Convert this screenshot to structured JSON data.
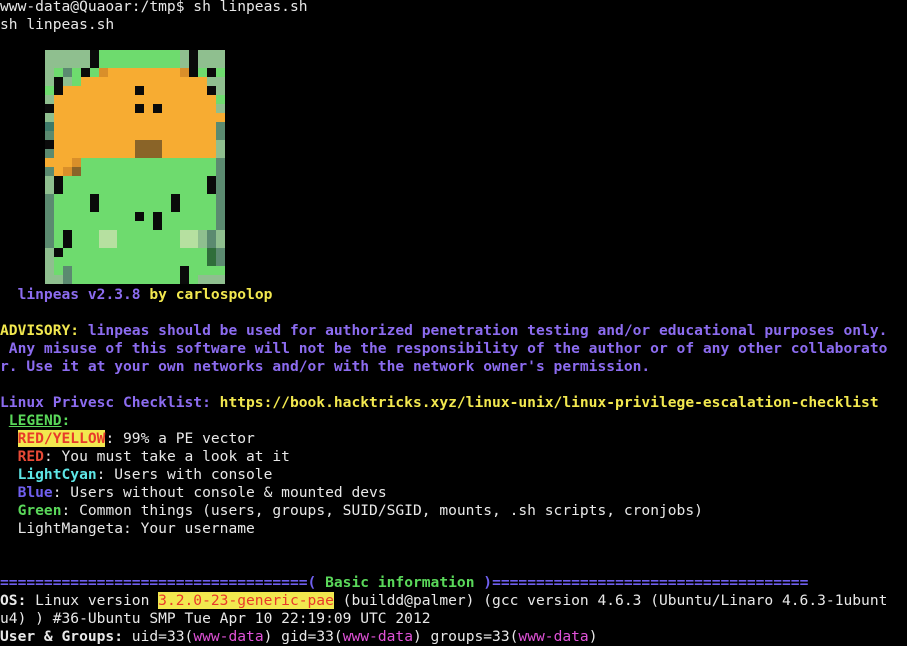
{
  "terminal": {
    "prompt_line": "www-data@Quaoar:/tmp$ sh linpeas.sh",
    "echo_line": "sh linpeas.sh",
    "banner": {
      "name": "linpeas v2.3.8",
      "by": "by",
      "author": "carlospolop"
    },
    "advisory": {
      "label": "ADVISORY:",
      "line1": " linpeas should be used for authorized penetration testing and/or educational purposes only.",
      "line2": " Any misuse of this software will not be the responsibility of the author or of any other collaborato",
      "line3": "r. Use it at your own networks and/or with the network owner's permission."
    },
    "checklist": {
      "label": "Linux Privesc Checklist:",
      "url": " https://book.hacktricks.xyz/linux-unix/linux-privilege-escalation-checklist"
    },
    "legend": {
      "title": "LEGEND",
      "colon": ":",
      "items": [
        {
          "key": "RED/YELLOW",
          "text": ": 99% a PE vector"
        },
        {
          "key": "RED",
          "text": ": You must take a look at it"
        },
        {
          "key": "LightCyan",
          "text": ": Users with console"
        },
        {
          "key": "Blue",
          "text": ": Users without console & mounted devs"
        },
        {
          "key": "Green",
          "text": ": Common things (users, groups, SUID/SGID, mounts, .sh scripts, cronjobs)"
        },
        {
          "key": "LightMangeta",
          "text": ": Your username"
        }
      ]
    },
    "section": {
      "left_rule": "===================================",
      "open": "(",
      "title": " Basic information ",
      "close": ")",
      "right_rule": "===================================="
    },
    "os": {
      "label": "OS:",
      "prefix": " Linux version ",
      "version": "3.2.0-23-generic-pae",
      "rest1": " (buildd@palmer) (gcc version 4.6.3 (Ubuntu/Linaro 4.6.3-1ubunt",
      "line2": "u4) ) #36-Ubuntu SMP Tue Apr 10 22:19:09 UTC 2012"
    },
    "user": {
      "label": "User & Groups:",
      "uid": " uid=33(",
      "user1": "www-data",
      "gid": ") gid=33(",
      "user2": "www-data",
      "groups": ") groups=33(",
      "user3": "www-data",
      "end": ")"
    },
    "colors": {
      "background": "#000000",
      "yellow": "#f2e84f",
      "purple": "#8c6cf0",
      "red": "#e84a36",
      "cyan": "#5ee6e6",
      "green": "#5ad85a",
      "magenta": "#e052d8"
    }
  }
}
